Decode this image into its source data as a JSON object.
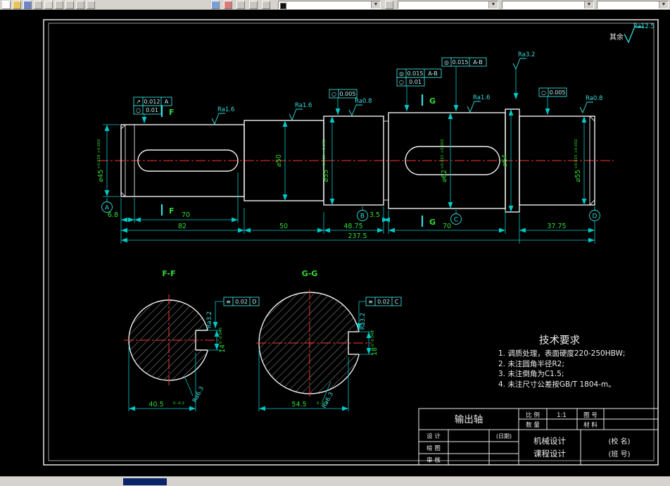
{
  "colors": {
    "background": "#000000",
    "line": "#00c8c8",
    "dim_text": "#32dc32",
    "geometry": "#f0f0f0",
    "centerline": "#ff3232",
    "toolbar": "#d6d3ce",
    "selection": "#0a246a"
  },
  "toolbar": {
    "icons": [
      "new-icon",
      "open-icon",
      "save-icon",
      "print-icon",
      "print-preview-icon",
      "find-icon",
      "cut-icon",
      "copy-icon",
      "paste-icon",
      "undo-icon",
      "redo-icon",
      "zoom-icon",
      "pan-icon",
      "redraw-icon"
    ],
    "combos": [
      "layer-combo",
      "color-combo",
      "linetype-combo",
      "lineweight-combo"
    ]
  },
  "drawing": {
    "general_roughness": {
      "prefix": "其余",
      "value": "Ra12.5"
    },
    "roughness": {
      "r1": "Ra1.6",
      "r2": "Ra1.6",
      "r3": "Ra0.8",
      "r4": "Ra1.6",
      "r5": "Ra3.2",
      "r6": "Ra0.8"
    },
    "frames": {
      "f1a_sym": "↗",
      "f1a_val": "0.012",
      "f1a_ref": "A",
      "f1b_sym": "○",
      "f1b_val": "0.01",
      "f2_sym": "○",
      "f2_val": "0.005",
      "f3a_sym": "◎",
      "f3a_val": "0.015",
      "f3a_ref": "A-B",
      "f3b_sym": "○",
      "f3b_val": "0.01",
      "f3c_sym": "◎",
      "f3c_val": "0.015",
      "f3c_ref": "A-B",
      "f4_sym": "○",
      "f4_val": "0.005",
      "f5_sym": "≡",
      "f5_val": "0.02",
      "f5_ref": "D",
      "f6_sym": "≡",
      "f6_val": "0.02",
      "f6_ref": "C"
    },
    "datums": {
      "a": "A",
      "b": "B",
      "c": "C",
      "d": "D"
    },
    "cuts": {
      "f": "F",
      "g": "G"
    },
    "dims": {
      "d1": "6.8",
      "d2": "70",
      "d3": "82",
      "d4": "50",
      "d5": "48.75",
      "d6": "3.5",
      "d7": "70",
      "d8": "37.75",
      "d9": "237.5"
    },
    "dias": {
      "dia1": "⌀45",
      "dia1_tol": "+0.018 +0.002",
      "dia2": "⌀50",
      "dia2_tol": "",
      "dia3": "⌀55",
      "dia3_tol": "+0.015 +0.002",
      "dia4": "⌀62",
      "dia4_tol": "+0.021 +0.002",
      "dia5": "⌀64",
      "dia5_tol": "",
      "dia6": "⌀55",
      "dia6_tol": "+0.015 +0.002"
    },
    "sections": {
      "ff_title": "F-F",
      "gg_title": "G-G",
      "ff_width": "40.5",
      "ff_width_tol": "0 -0.2",
      "ff_key": "14",
      "ff_key_tol": "0 -0.043",
      "gg_width": "54.5",
      "gg_width_tol": "0 -0.2",
      "gg_key": "18",
      "gg_key_tol": "0 -0.043",
      "ff_rough_side": "Ra3.2",
      "ff_rough_bottom": "Ra6.3",
      "gg_rough_side": "Ra3.2",
      "gg_rough_bottom": "Ra6.3"
    },
    "tech_req": {
      "title": "技术要求",
      "item1": "1. 调质处理，表面硬度220-250HBW;",
      "item2": "2. 未注圆角半径R2;",
      "item3": "3. 未注倒角为C1.5;",
      "item4": "4. 未注尺寸公差按GB/T 1804-m。"
    },
    "title_block": {
      "part_name": "输出轴",
      "scale_label": "比 例",
      "scale_value": "1:1",
      "qty_label": "数 量",
      "drawno_label": "图 号",
      "material_label": "材 料",
      "design_label": "设 计",
      "draft_label": "绘 图",
      "check_label": "审 核",
      "date_label": "(日期)",
      "course_line1": "机械设计",
      "course_line2": "课程设计",
      "school": "(校 名)",
      "class_no": "(班 号)"
    }
  }
}
